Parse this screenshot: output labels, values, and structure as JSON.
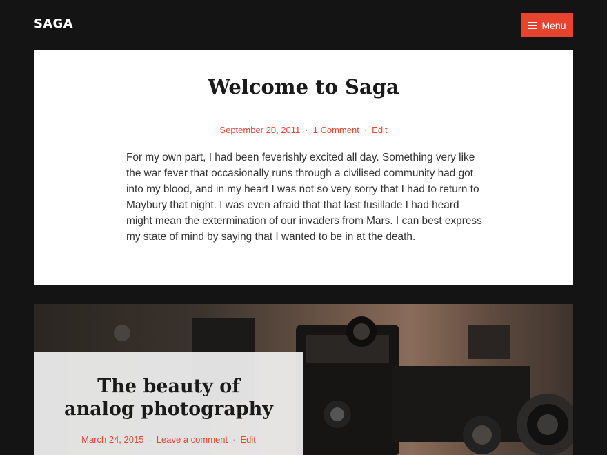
{
  "header": {
    "site_title": "SAGA",
    "menu_label": "Menu",
    "menu_icon": "hamburger-icon"
  },
  "post1": {
    "title": "Welcome to Saga",
    "date": "September 20, 2011",
    "comments": "1 Comment",
    "edit": "Edit",
    "separator": "·",
    "body": "For my own part, I had been feverishly excited all day. Something very like the war fever that occasionally runs through a civilised community had got into my blood, and in my heart I was not so very sorry that I had to return to Maybury that night. I was even afraid that that last fusillade I had heard might mean the extermination of our invaders from Mars. I can best express my state of mind by saying that I wanted to be in at the death."
  },
  "post2": {
    "title_line1": "The beauty of",
    "title_line2": "analog photography",
    "date": "March 24, 2015",
    "comments": "Leave a comment",
    "edit": "Edit",
    "separator": "·",
    "image": "vintage-cameras-photo"
  },
  "colors": {
    "background": "#141414",
    "accent": "#e8432f",
    "card": "#ffffff"
  }
}
